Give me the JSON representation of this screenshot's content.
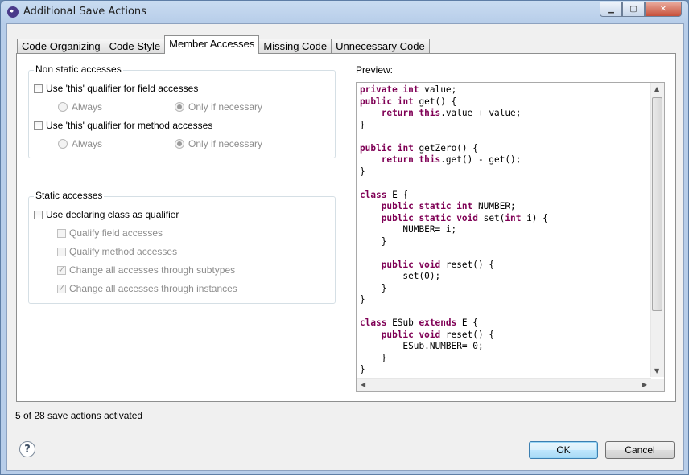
{
  "window": {
    "title": "Additional Save Actions",
    "caption_buttons": {
      "minimize": "▁",
      "maximize": "▢",
      "close": "✕"
    }
  },
  "tabs": [
    {
      "label": "Code Organizing",
      "active": false
    },
    {
      "label": "Code Style",
      "active": false
    },
    {
      "label": "Member Accesses",
      "active": true
    },
    {
      "label": "Missing Code",
      "active": false
    },
    {
      "label": "Unnecessary Code",
      "active": false
    }
  ],
  "non_static": {
    "legend": "Non static accesses",
    "field_checkbox": {
      "label": "Use 'this' qualifier for field accesses",
      "checked": false
    },
    "field_always": {
      "label": "Always",
      "selected": false
    },
    "field_if_necessary": {
      "label": "Only if necessary",
      "selected": true
    },
    "method_checkbox": {
      "label": "Use 'this' qualifier for method accesses",
      "checked": false
    },
    "method_always": {
      "label": "Always",
      "selected": false
    },
    "method_if_necessary": {
      "label": "Only if necessary",
      "selected": true
    }
  },
  "static": {
    "legend": "Static accesses",
    "declaring_class": {
      "label": "Use declaring class as qualifier",
      "checked": false
    },
    "qualify_field": {
      "label": "Qualify field accesses",
      "checked": false
    },
    "qualify_method": {
      "label": "Qualify method accesses",
      "checked": false
    },
    "through_subtypes": {
      "label": "Change all accesses through subtypes",
      "checked": true
    },
    "through_instances": {
      "label": "Change all accesses through instances",
      "checked": true
    }
  },
  "preview": {
    "label": "Preview:",
    "code": [
      "<kw>private</kw> <kw>int</kw> value;",
      "<kw>public</kw> <kw>int</kw> get() {",
      "    <kw>return</kw> <kw>this</kw>.value + value;",
      "}",
      "",
      "<kw>public</kw> <kw>int</kw> getZero() {",
      "    <kw>return</kw> <kw>this</kw>.get() - get();",
      "}",
      "",
      "<kw>class</kw> E {",
      "    <kw>public</kw> <kw>static</kw> <kw>int</kw> NUMBER;",
      "    <kw>public</kw> <kw>static</kw> <kw>void</kw> set(<kw>int</kw> i) {",
      "        NUMBER= i;",
      "    }",
      "",
      "    <kw>public</kw> <kw>void</kw> reset() {",
      "        set(0);",
      "    }",
      "}",
      "",
      "<kw>class</kw> ESub <kw>extends</kw> E {",
      "    <kw>public</kw> <kw>void</kw> reset() {",
      "        ESub.NUMBER= 0;",
      "    }",
      "}"
    ]
  },
  "status_text": "5 of 28 save actions activated",
  "help_glyph": "?",
  "buttons": {
    "ok": "OK",
    "cancel": "Cancel"
  },
  "colors": {
    "keyword": "#7f0055",
    "default_button_border": "#3c7fb1"
  }
}
